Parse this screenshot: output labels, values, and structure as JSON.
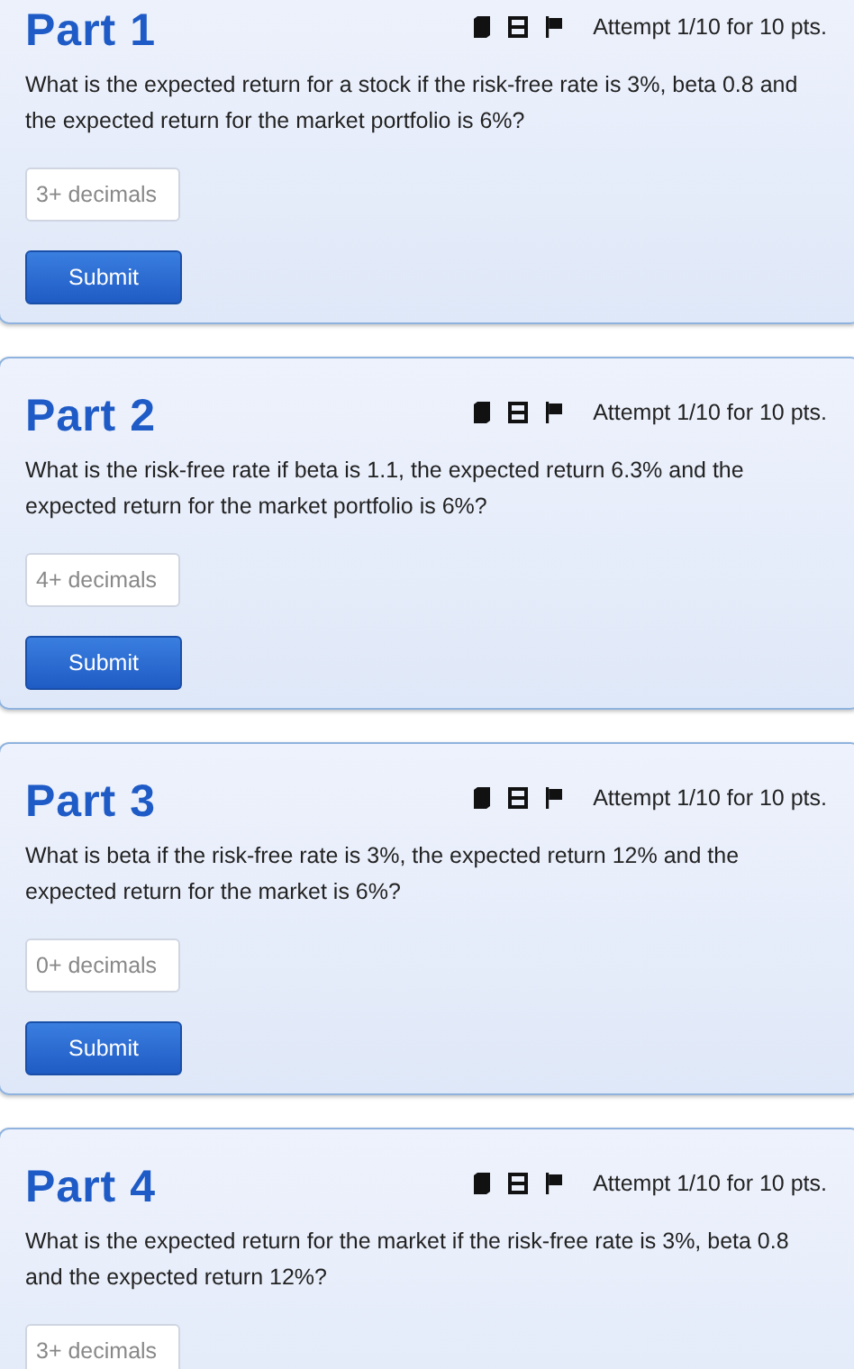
{
  "parts": [
    {
      "title": "Part 1",
      "attempt": "Attempt 1/10 for 10 pts.",
      "question": "What is the expected return for a stock if the risk-free rate is 3%, beta 0.8 and the expected return for the market portfolio is 6%?",
      "answer": {
        "placeholder": "3+ decimals"
      },
      "submit": "Submit"
    },
    {
      "title": "Part 2",
      "attempt": "Attempt 1/10 for 10 pts.",
      "question": "What is the risk-free rate if beta is 1.1, the expected return 6.3% and the expected return for the market portfolio is 6%?",
      "answer": {
        "placeholder": "4+ decimals"
      },
      "submit": "Submit"
    },
    {
      "title": "Part 3",
      "attempt": "Attempt 1/10 for 10 pts.",
      "question": "What is beta if the risk-free rate is 3%, the expected return 12% and the expected return for the market is 6%?",
      "answer": {
        "placeholder": "0+ decimals"
      },
      "submit": "Submit"
    },
    {
      "title": "Part 4",
      "attempt": "Attempt 1/10 for 10 pts.",
      "question": "What is the expected return for the market if the risk-free rate is 3%, beta 0.8 and the expected return 12%?",
      "answer": {
        "placeholder": "3+ decimals"
      }
    }
  ]
}
